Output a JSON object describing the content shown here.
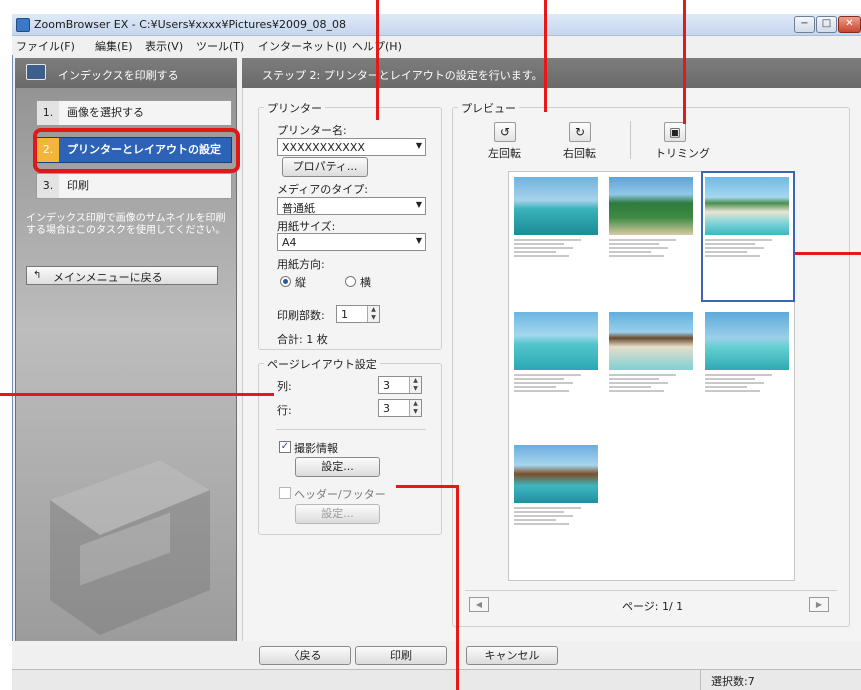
{
  "window": {
    "title": "ZoomBrowser EX - C:¥Users¥xxxx¥Pictures¥2009_08_08",
    "controls": {
      "minimize": "−",
      "maximize": "□",
      "close": "✕"
    }
  },
  "menu": [
    "ファイル(F)",
    "編集(E)",
    "表示(V)",
    "ツール(T)",
    "インターネット(I)",
    "ヘルプ(H)"
  ],
  "left_panel": {
    "title": "インデックスを印刷する",
    "steps": [
      {
        "num": "1.",
        "label": "画像を選択する"
      },
      {
        "num": "2.",
        "label": "プリンターとレイアウトの設定"
      },
      {
        "num": "3.",
        "label": "印刷"
      }
    ],
    "note": "インデックス印刷で画像のサムネイルを印刷する場合はこのタスクを使用してください。",
    "return_button": "メインメニューに戻る"
  },
  "main": {
    "header": "ステップ 2: プリンターとレイアウトの設定を行います。",
    "printer": {
      "group_label": "プリンター",
      "name_label": "プリンター名:",
      "name_value": "XXXXXXXXXXX",
      "properties_button": "プロパティ...",
      "media_label": "メディアのタイプ:",
      "media_value": "普通紙",
      "paper_size_label": "用紙サイズ:",
      "paper_size_value": "A4",
      "orientation_label": "用紙方向:",
      "orientation_portrait": "縦",
      "orientation_landscape": "横",
      "copies_label": "印刷部数:",
      "copies_value": "1",
      "total_label": "合計: 1 枚"
    },
    "page_layout": {
      "group_label": "ページレイアウト設定",
      "columns_label": "列:",
      "columns_value": "3",
      "rows_label": "行:",
      "rows_value": "3",
      "shooting_info_label": "撮影情報",
      "shooting_info_checked": true,
      "settings_button": "設定...",
      "header_footer_label": "ヘッダー/フッター",
      "header_footer_checked": false,
      "settings_button_disabled": "設定..."
    },
    "preview": {
      "group_label": "プレビュー",
      "rotate_left": "左回転",
      "rotate_right": "右回転",
      "trimming": "トリミング",
      "page_indicator": "ページ: 1/ 1",
      "thumbnails": [
        "dock-boat",
        "palm-beach",
        "island-beach",
        "water-villas",
        "beach-umbrella",
        "pier",
        "stilt-house"
      ]
    }
  },
  "bottom": {
    "back_button": "〈戻る",
    "print_button": "印刷",
    "cancel_button": "キャンセル"
  },
  "status": {
    "selection": "選択数:7"
  },
  "colors": {
    "accent": "#2d63b6",
    "highlight": "#e01818",
    "step_num": "#f4b63a"
  }
}
